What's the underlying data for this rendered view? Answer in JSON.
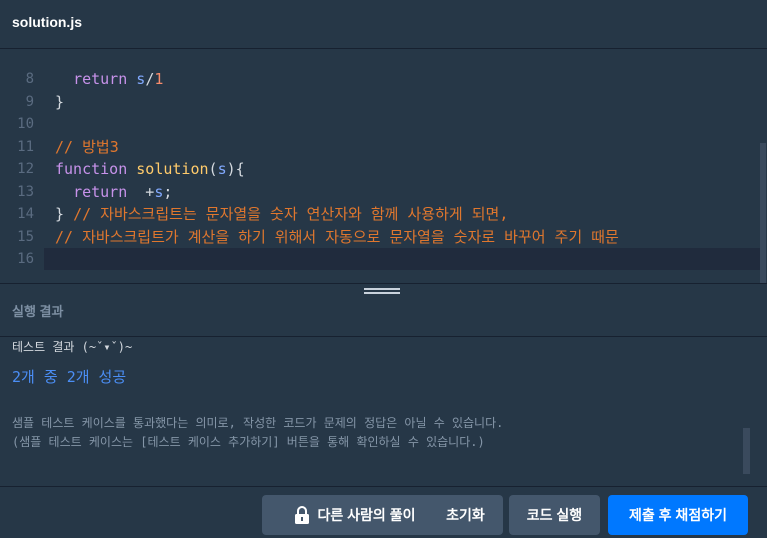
{
  "tab": {
    "title": "solution.js"
  },
  "editor": {
    "lines": [
      {
        "num": "8",
        "tokens": [
          {
            "t": "  ",
            "c": "punc"
          },
          {
            "t": "return",
            "c": "kw"
          },
          {
            "t": " ",
            "c": "punc"
          },
          {
            "t": "s",
            "c": "var"
          },
          {
            "t": "/",
            "c": "punc"
          },
          {
            "t": "1",
            "c": "num"
          }
        ]
      },
      {
        "num": "9",
        "tokens": [
          {
            "t": "}",
            "c": "punc"
          }
        ]
      },
      {
        "num": "10",
        "tokens": []
      },
      {
        "num": "11",
        "tokens": [
          {
            "t": "// 방법3",
            "c": "cmt"
          }
        ]
      },
      {
        "num": "12",
        "tokens": [
          {
            "t": "function",
            "c": "kw"
          },
          {
            "t": " ",
            "c": "punc"
          },
          {
            "t": "solution",
            "c": "fn"
          },
          {
            "t": "(",
            "c": "punc"
          },
          {
            "t": "s",
            "c": "var"
          },
          {
            "t": "){",
            "c": "punc"
          }
        ]
      },
      {
        "num": "13",
        "tokens": [
          {
            "t": "  ",
            "c": "punc"
          },
          {
            "t": "return",
            "c": "kw"
          },
          {
            "t": "  +",
            "c": "punc"
          },
          {
            "t": "s",
            "c": "var"
          },
          {
            "t": ";",
            "c": "punc"
          }
        ]
      },
      {
        "num": "14",
        "tokens": [
          {
            "t": "} ",
            "c": "punc"
          },
          {
            "t": "// 자바스크립트는 문자열을 숫자 연산자와 함께 사용하게 되면,",
            "c": "cmt"
          }
        ]
      },
      {
        "num": "15",
        "tokens": [
          {
            "t": "// 자바스크립트가 계산을 하기 위해서 자동으로 문자열을 숫자로 바꾸어 주기 때문",
            "c": "cmt"
          }
        ]
      },
      {
        "num": "16",
        "tokens": [],
        "active": true
      }
    ]
  },
  "result": {
    "title": "실행 결과",
    "label": "테스트 결과 (~ˇ▾ˇ)~",
    "success": "2개 중 2개 성공",
    "note1": "샘플 테스트 케이스를 통과했다는 의미로, 작성한 코드가 문제의 정답은 아닐 수 있습니다.",
    "note2": "(샘플 테스트 케이스는 [테스트 케이스 추가하기] 버튼을 통해 확인하실 수 있습니다.)"
  },
  "footer": {
    "other_solutions_label": "다른 사람의 풀이",
    "reset_label": "초기화",
    "run_label": "코드 실행",
    "submit_label": "제출 후 채점하기"
  },
  "colors": {
    "background": "#263747",
    "primary": "#0078ff",
    "button": "#44576c",
    "comment": "#e0772e",
    "keyword": "#c792ea",
    "function": "#ffcb6b",
    "success": "#4b8ef5"
  },
  "icons": {
    "lock": "lock-icon",
    "grip": "drag-handle-icon"
  }
}
